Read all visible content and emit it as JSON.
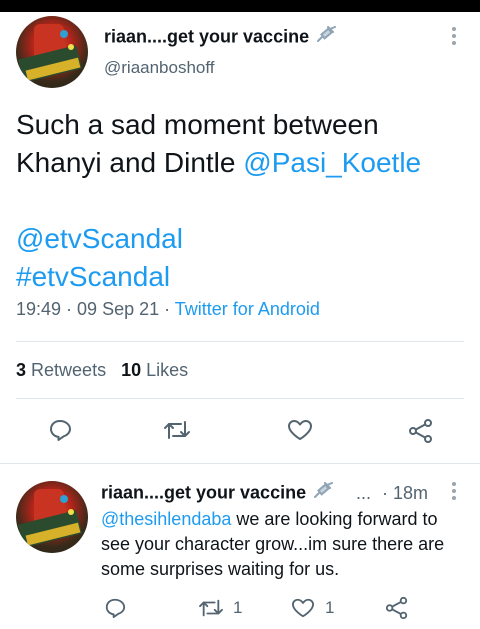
{
  "tweet": {
    "author_name": "riaan....get your vaccine",
    "author_handle": "@riaanboshoff",
    "text_line1": "Such a sad moment between",
    "text_line2_prefix": "Khanyi and Dintle ",
    "mention1": "@Pasi_Koetle",
    "mention2": "@etvScandal",
    "hashtag": "#etvScandal",
    "time": "19:49",
    "date": "09 Sep 21",
    "source": "Twitter for Android",
    "retweets_count": "3",
    "retweets_label": "Retweets",
    "likes_count": "10",
    "likes_label": "Likes"
  },
  "reply": {
    "author_name": "riaan....get your vaccine",
    "ellipsis": "...",
    "time": "18m",
    "mention": "@thesihlendaba",
    "text": " we are looking forward to see your character grow...im sure there are some surprises waiting for us.",
    "retweet_count": "1",
    "like_count": "1"
  },
  "colors": {
    "link": "#1d9bf0",
    "secondary": "#536471",
    "primary_text": "#0f1419",
    "divider": "#e1e6ea"
  },
  "icons": [
    "syringe-icon",
    "more-icon",
    "reply-icon",
    "retweet-icon",
    "like-icon",
    "share-icon"
  ]
}
